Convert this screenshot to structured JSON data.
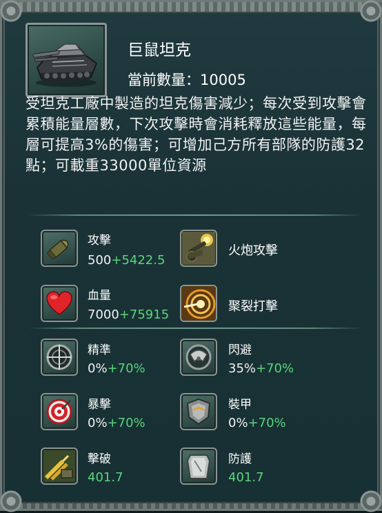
{
  "unit": {
    "name": "巨鼠坦克",
    "count_label": "當前數量：",
    "count_value": "10005",
    "description": "受坦克工廠中製造的坦克傷害減少；每次受到攻擊會累積能量層數，下次攻擊時會消耗釋放這些能量，每層可提高3%的傷害；可增加己方所有部隊的防護32點；可載重33000單位資源"
  },
  "primary_stats": {
    "attack": {
      "label": "攻擊",
      "base": "500",
      "bonus": "+5422.5",
      "icon": "shell-icon"
    },
    "skill_1": {
      "label": "火炮攻擊",
      "icon": "cannon-icon"
    },
    "hp": {
      "label": "血量",
      "base": "7000",
      "bonus": "+75915",
      "icon": "heart-icon"
    },
    "skill_2": {
      "label": "聚裂打擊",
      "icon": "burst-icon"
    }
  },
  "secondary_stats": {
    "accuracy": {
      "label": "精準",
      "base": "0%",
      "bonus": "+70%",
      "icon": "crosshair-icon"
    },
    "dodge": {
      "label": "閃避",
      "base": "35%",
      "bonus": "+70%",
      "icon": "radar-icon"
    },
    "crit": {
      "label": "暴擊",
      "base": "0%",
      "bonus": "+70%",
      "icon": "target-icon"
    },
    "armor": {
      "label": "裝甲",
      "base": "0%",
      "bonus": "+70%",
      "icon": "armor-plate-icon"
    },
    "penetration": {
      "label": "擊破",
      "value": "401.7",
      "icon": "bullets-icon"
    },
    "defense": {
      "label": "防護",
      "value": "401.7",
      "icon": "shield-icon"
    }
  },
  "colors": {
    "bonus_green": "#5ad67c",
    "panel_bg": "#1c3438",
    "frame": "#6f7a78"
  }
}
